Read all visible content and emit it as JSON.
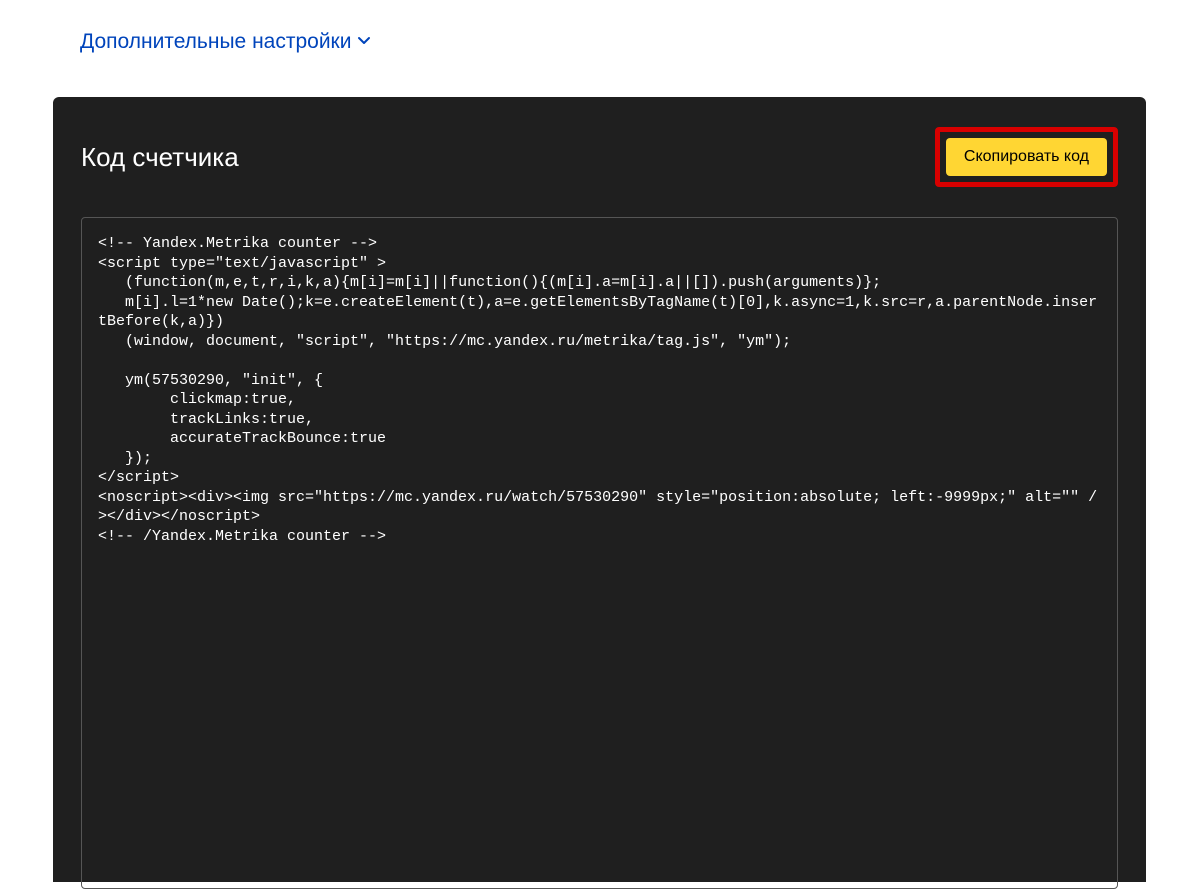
{
  "additionalSettings": {
    "label": "Дополнительные настройки"
  },
  "panel": {
    "title": "Код счетчика",
    "copyButton": "Скопировать код"
  },
  "code": "<!-- Yandex.Metrika counter -->\n<script type=\"text/javascript\" >\n   (function(m,e,t,r,i,k,a){m[i]=m[i]||function(){(m[i].a=m[i].a||[]).push(arguments)};\n   m[i].l=1*new Date();k=e.createElement(t),a=e.getElementsByTagName(t)[0],k.async=1,k.src=r,a.parentNode.insertBefore(k,a)})\n   (window, document, \"script\", \"https://mc.yandex.ru/metrika/tag.js\", \"ym\");\n\n   ym(57530290, \"init\", {\n        clickmap:true,\n        trackLinks:true,\n        accurateTrackBounce:true\n   });\n</script>\n<noscript><div><img src=\"https://mc.yandex.ru/watch/57530290\" style=\"position:absolute; left:-9999px;\" alt=\"\" /></div></noscript>\n<!-- /Yandex.Metrika counter -->"
}
